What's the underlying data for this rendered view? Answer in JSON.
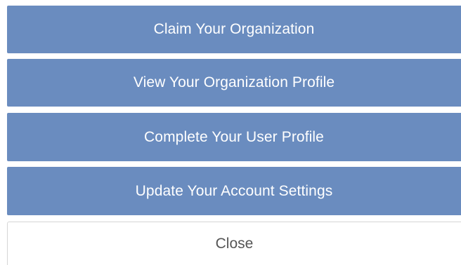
{
  "menu": {
    "items": [
      {
        "label": "Claim Your Organization"
      },
      {
        "label": "View Your Organization Profile"
      },
      {
        "label": "Complete Your User Profile"
      },
      {
        "label": "Update Your Account Settings"
      }
    ],
    "close_label": "Close"
  },
  "colors": {
    "button_bg": "#6a8cbf",
    "button_text": "#ffffff",
    "close_bg": "#ffffff",
    "close_text": "#555555",
    "close_border": "#d6d6d6"
  }
}
